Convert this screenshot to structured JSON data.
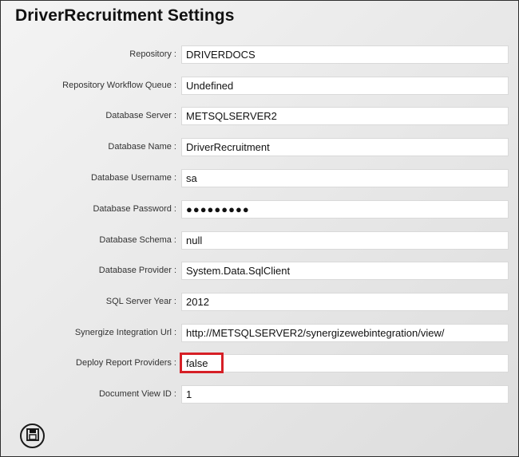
{
  "window": {
    "title": "DriverRecruitment Settings"
  },
  "settings": [
    {
      "label": "Repository :",
      "value": "DRIVERDOCS"
    },
    {
      "label": "Repository Workflow Queue :",
      "value": "Undefined"
    },
    {
      "label": "Database Server :",
      "value": "METSQLSERVER2"
    },
    {
      "label": "Database Name :",
      "value": "DriverRecruitment"
    },
    {
      "label": "Database Username :",
      "value": "sa"
    },
    {
      "label": "Database Password :",
      "value": "●●●●●●●●●",
      "masked": true
    },
    {
      "label": "Database Schema :",
      "value": "null"
    },
    {
      "label": "Database Provider :",
      "value": "System.Data.SqlClient"
    },
    {
      "label": "SQL Server Year :",
      "value": "2012"
    },
    {
      "label": "Synergize Integration Url :",
      "value": "http://METSQLSERVER2/synergizewebintegration/view/"
    },
    {
      "label": "Deploy Report Providers :",
      "value": "false",
      "highlighted": true
    },
    {
      "label": "Document View ID :",
      "value": "1"
    }
  ],
  "toolbar": {
    "save_icon": "save-icon"
  },
  "colors": {
    "highlight": "#d61f26",
    "background": "#e7e7e7",
    "field": "#ffffff"
  }
}
